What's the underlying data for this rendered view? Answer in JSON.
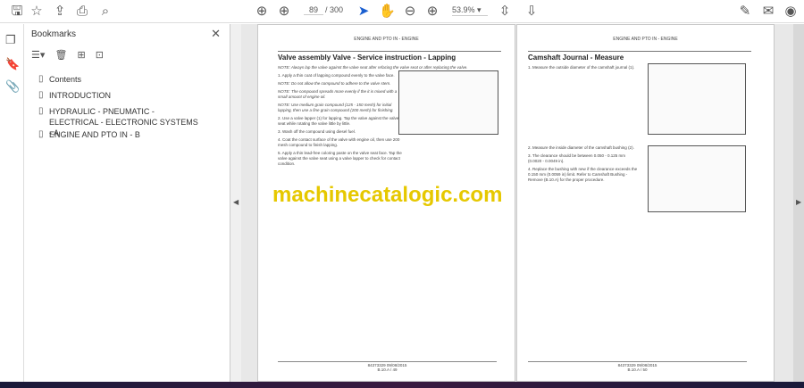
{
  "toolbar": {
    "page_current": "89",
    "page_total": "/ 300",
    "zoom": "53.9%"
  },
  "bookmarks": {
    "title": "Bookmarks",
    "items": [
      {
        "label": "Contents"
      },
      {
        "label": "INTRODUCTION"
      },
      {
        "label": "HYDRAULIC - PNEUMATIC - ELECTRICAL - ELECTRONIC SYSTEMS - A"
      },
      {
        "label": "ENGINE AND PTO IN - B"
      }
    ]
  },
  "left_page": {
    "header": "ENGINE AND PTO IN - ENGINE",
    "title": "Valve assembly Valve - Service instruction - Lapping",
    "note0": "NOTE: Always lap the valve against the valve seat after refacing the valve seat or after replacing the valve.",
    "step1": "1.  Apply a thin coat of lapping compound evenly to the valve face.",
    "note1": "NOTE: Do not allow the compound to adhere to the valve stem.",
    "note2": "NOTE: The compound spreads more evenly if the it is mixed with a small amount of engine oil.",
    "note3": "NOTE: Use medium grain compound (125 - 150 mesh) for initial lapping, then use a fine grain compound (200 mesh) for finishing.",
    "step2": "2.  Use a valve lapper (1) for lapping. Tap the valve against the valve seat while rotating the valve little by little.",
    "step3": "3.  Wash off the compound using diesel fuel.",
    "step4": "4.  Coat the contact surface of the valve with engine oil, then use 200 mesh compound to finish lapping.",
    "step5": "5.  Apply a thin lead-free coloring paste on the valve seat face. Tap the valve against the valve seat using a valve lapper to check for contact condition.",
    "footer_code": "84373329 09/08/2015",
    "footer_page": "B.10.A / 49"
  },
  "right_page": {
    "header": "ENGINE AND PTO IN - ENGINE",
    "title": "Camshaft Journal - Measure",
    "step1": "1.  Measure the outside diameter of the camshaft journal (1).",
    "step2": "2.  Measure the inside diameter of the camshaft bushing (2).",
    "step3": "3.  The clearance should be between 0.050 - 0.125 mm (0.0020 - 0.0049 in).",
    "step4": "4.  Replace the bushing with new if the clearance exceeds the 0.150 mm (0.0059 in) limit. Refer to Camshaft Bushing - Remove (B.10.A) for the proper procedure.",
    "footer_code": "84373329 09/08/2015",
    "footer_page": "B.10.A / 50"
  },
  "watermark": "machinecatalogic.com"
}
